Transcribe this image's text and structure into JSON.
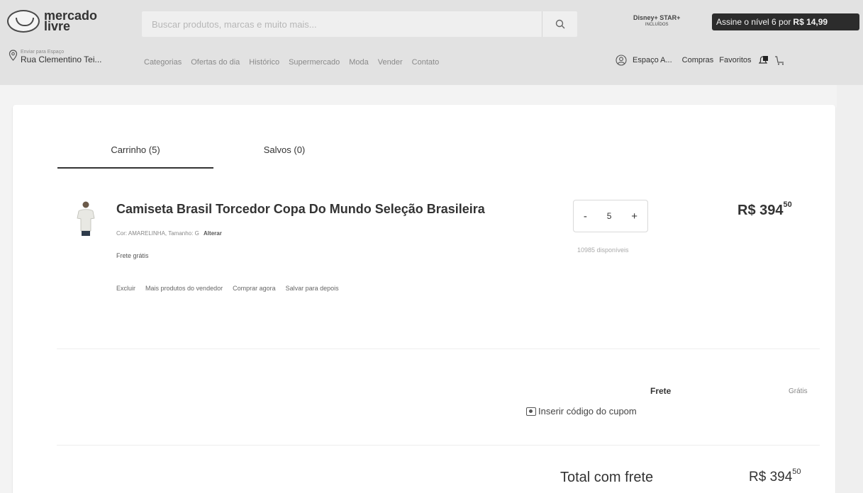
{
  "header": {
    "logo_text": "mercado livre",
    "search_placeholder": "Buscar produtos, marcas e muito mais...",
    "promo_logo": "Disney+ STAR+",
    "promo_logo_sub": "INCLUÍDOS",
    "promo_text": "Assine o nível 6 por",
    "promo_price": "R$ 14,99",
    "location_small": "Enviar para Espaço",
    "location_main": "Rua Clementino Tei...",
    "nav": [
      "Categorias",
      "Ofertas do dia",
      "Histórico",
      "Supermercado",
      "Moda",
      "Vender",
      "Contato"
    ],
    "account_label": "Espaço A...",
    "purchases_label": "Compras",
    "favorites_label": "Favoritos"
  },
  "tabs": {
    "cart_label": "Carrinho (5)",
    "saved_label": "Salvos (0)"
  },
  "product": {
    "title": "Camiseta Brasil Torcedor Copa Do Mundo Seleção Brasileira",
    "variant": "Cor: AMARELINHA, Tamanho: G",
    "change_label": "Alterar",
    "shipping": "Frete grátis",
    "actions": [
      "Excluir",
      "Mais produtos do vendedor",
      "Comprar agora",
      "Salvar para depois"
    ],
    "quantity": "5",
    "decrement_label": "-",
    "increment_label": "+",
    "available": "10985 disponíveis",
    "price_int": "R$ 394",
    "price_cents": "50"
  },
  "summary": {
    "frete_label": "Frete",
    "frete_value": "Grátis",
    "coupon_label": "Inserir código do cupom",
    "total_label": "Total com frete",
    "total_int": "R$ 394",
    "total_cents": "50"
  },
  "colors": {
    "header_bg": "#e2e2e2",
    "page_bg": "#f3f3f3",
    "promo_bg": "#2c2c2c"
  }
}
